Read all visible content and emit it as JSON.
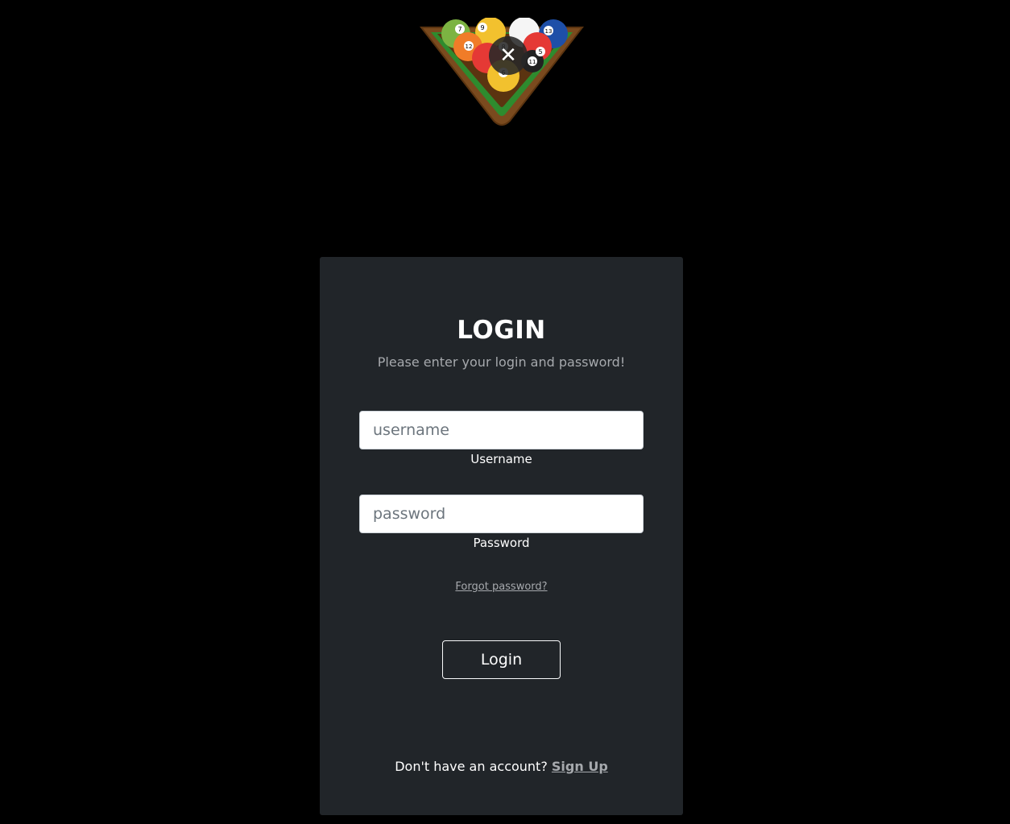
{
  "logo": {
    "icon": "billiard-ball-rack-icon",
    "ball_numbers": [
      "7",
      "9",
      "13",
      "12",
      "8",
      "5",
      "11",
      "6"
    ]
  },
  "overlay": {
    "close_icon": "close-icon",
    "close_glyph": "✕"
  },
  "login_card": {
    "title": "LOGIN",
    "subtitle": "Please enter your login and password!",
    "username": {
      "placeholder": "username",
      "value": "",
      "label": "Username"
    },
    "password": {
      "placeholder": "password",
      "value": "",
      "label": "Password"
    },
    "forgot_password": "Forgot password?",
    "login_button": "Login",
    "signup_prompt": "Don't have an account?",
    "signup_link": "Sign Up"
  },
  "colors": {
    "page_background": "#000000",
    "card_background": "#212529",
    "muted_text": "#a6a9ad"
  }
}
